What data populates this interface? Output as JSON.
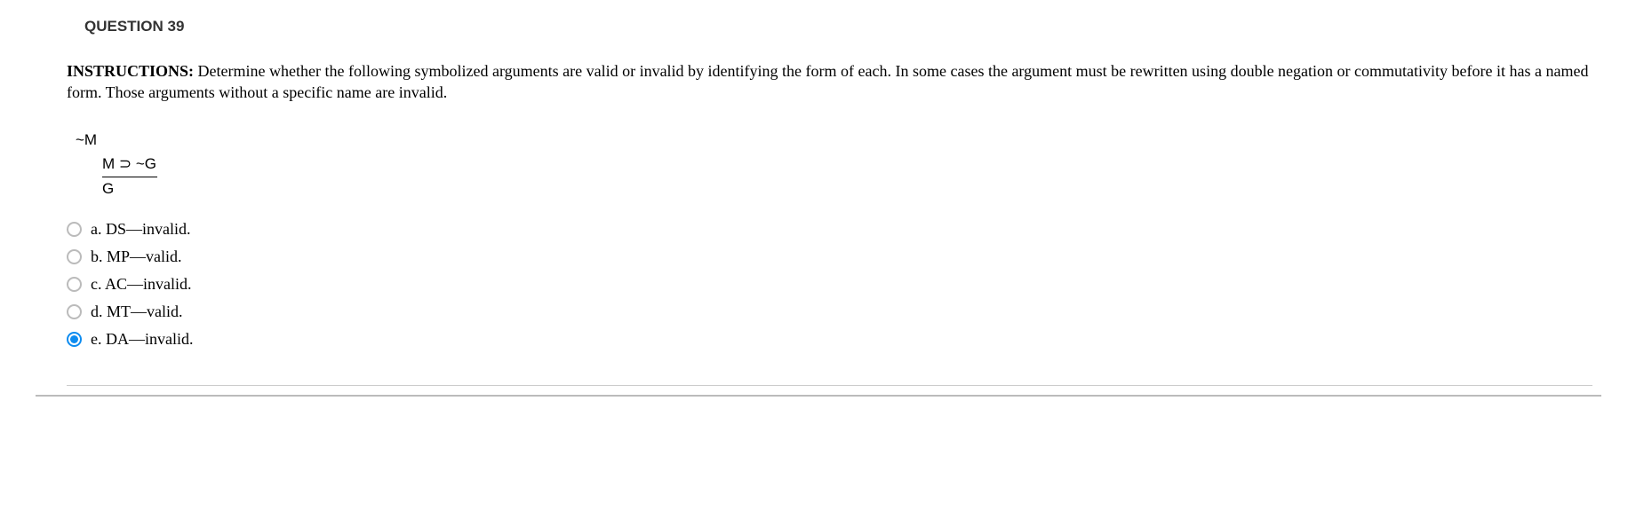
{
  "question": {
    "header": "QUESTION 39",
    "instructions_label": "INSTRUCTIONS: ",
    "instructions_body": "Determine whether the following symbolized arguments are valid or invalid by identifying the form of each. In some cases the argument must be rewritten using double negation or commutativity before it has a named form. Those arguments without a specific name are invalid.",
    "argument": {
      "premise1": "~M",
      "premise2": "M ⊃ ~G",
      "conclusion": "G"
    },
    "options": [
      {
        "letter": "a.",
        "text": "DS—invalid.",
        "selected": false
      },
      {
        "letter": "b.",
        "text": "MP—valid.",
        "selected": false
      },
      {
        "letter": "c.",
        "text": "AC—invalid.",
        "selected": false
      },
      {
        "letter": "d.",
        "text": "MT—valid.",
        "selected": false
      },
      {
        "letter": "e.",
        "text": "DA—invalid.",
        "selected": true
      }
    ]
  }
}
